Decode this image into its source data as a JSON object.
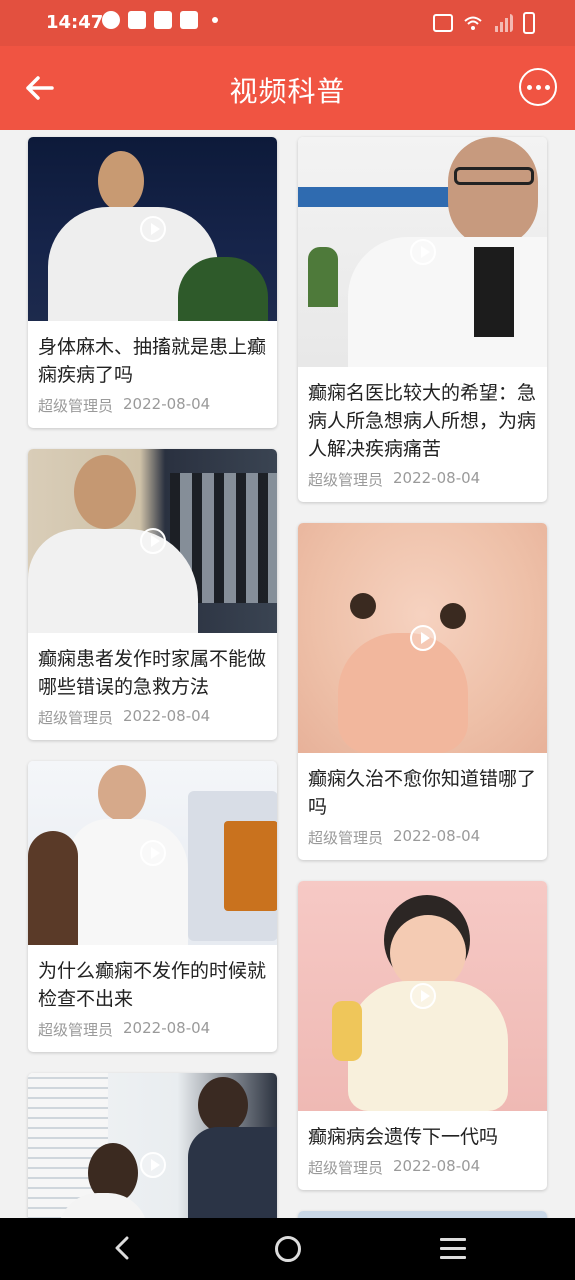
{
  "status": {
    "time": "14:47"
  },
  "header": {
    "title": "视频科普",
    "back_icon": "arrow-left-icon",
    "more_icon": "more-dots-icon"
  },
  "colors": {
    "header_bg": "#f05442",
    "status_bg": "#e3503f",
    "meta_text": "#9a9a9a"
  },
  "left_column": [
    {
      "title": "身体麻木、抽搐就是患上癫痫疾病了吗",
      "author": "超级管理员",
      "date": "2022-08-04"
    },
    {
      "title": "癫痫患者发作时家属不能做哪些错误的急救方法",
      "author": "超级管理员",
      "date": "2022-08-04"
    },
    {
      "title": "为什么癫痫不发作的时候就检查不出来",
      "author": "超级管理员",
      "date": "2022-08-04"
    },
    {
      "title": "",
      "author": "",
      "date": ""
    }
  ],
  "right_column": [
    {
      "title": "癫痫名医比较大的希望：急病人所急想病人所想，为病人解决疾病痛苦",
      "author": "超级管理员",
      "date": "2022-08-04"
    },
    {
      "title": "癫痫久治不愈你知道错哪了吗",
      "author": "超级管理员",
      "date": "2022-08-04"
    },
    {
      "title": "癫痫病会遗传下一代吗",
      "author": "超级管理员",
      "date": "2022-08-04"
    }
  ],
  "navbar": {
    "back_icon": "nav-back-icon",
    "home_icon": "nav-home-icon",
    "menu_icon": "nav-menu-icon"
  }
}
